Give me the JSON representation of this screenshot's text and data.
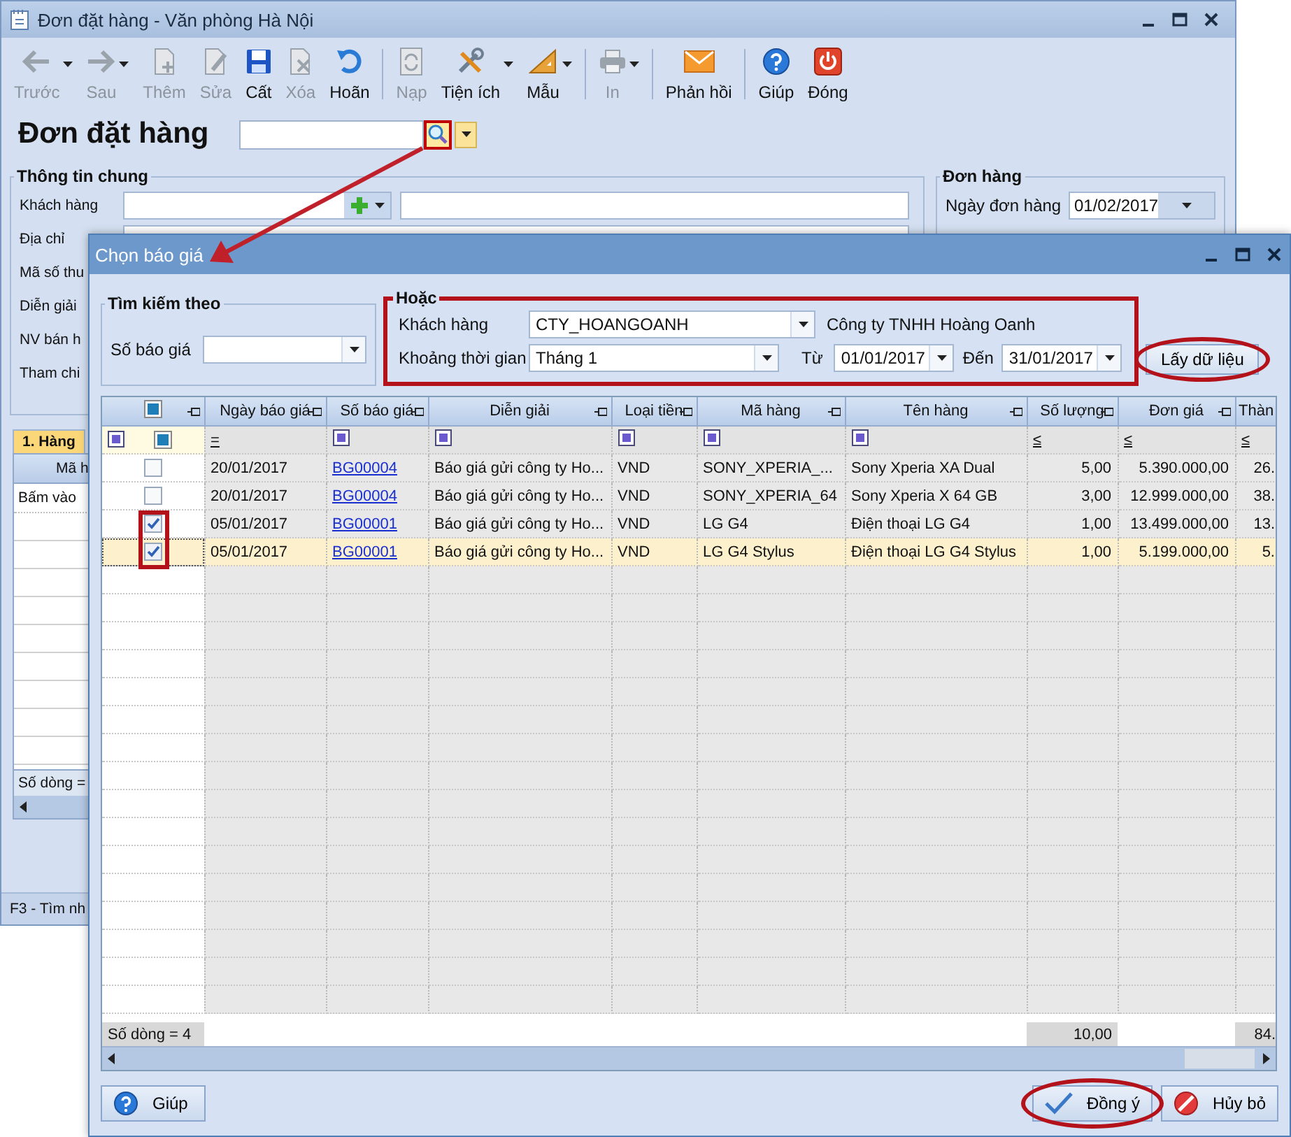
{
  "main_window": {
    "title": "Đơn đặt hàng - Văn phòng Hà Nội",
    "toolbar": [
      {
        "kind": "button",
        "label": "Trước",
        "disabled": true,
        "dropdown": true
      },
      {
        "kind": "button",
        "label": "Sau",
        "disabled": true,
        "dropdown": true
      },
      {
        "kind": "button",
        "label": "Thêm",
        "disabled": true,
        "dropdown": false
      },
      {
        "kind": "button",
        "label": "Sửa",
        "disabled": true,
        "dropdown": false
      },
      {
        "kind": "button",
        "label": "Cất",
        "disabled": false,
        "dropdown": false
      },
      {
        "kind": "button",
        "label": "Xóa",
        "disabled": true,
        "dropdown": false
      },
      {
        "kind": "button",
        "label": "Hoãn",
        "disabled": false,
        "dropdown": false
      },
      {
        "kind": "separator"
      },
      {
        "kind": "button",
        "label": "Nạp",
        "disabled": true,
        "dropdown": false
      },
      {
        "kind": "button",
        "label": "Tiện ích",
        "disabled": false,
        "dropdown": true
      },
      {
        "kind": "button",
        "label": "Mẫu",
        "disabled": false,
        "dropdown": true
      },
      {
        "kind": "separator"
      },
      {
        "kind": "button",
        "label": "In",
        "disabled": true,
        "dropdown": true
      },
      {
        "kind": "separator"
      },
      {
        "kind": "button",
        "label": "Phản hồi",
        "disabled": false,
        "dropdown": false
      },
      {
        "kind": "separator"
      },
      {
        "kind": "button",
        "label": "Giúp",
        "disabled": false,
        "dropdown": false
      },
      {
        "kind": "button",
        "label": "Đóng",
        "disabled": false,
        "dropdown": false
      }
    ],
    "heading": "Đơn đặt hàng",
    "general_info": {
      "title": "Thông tin chung",
      "labels": [
        "Khách hàng",
        "Địa chỉ",
        "Mã số thu",
        "Diễn giải",
        "NV bán h",
        "Tham chi"
      ]
    },
    "order_info": {
      "title": "Đơn hàng",
      "date_label": "Ngày đơn hàng",
      "date_value": "01/02/2017"
    },
    "detail_tabs": [
      {
        "label": "1. Hàng",
        "selected": true
      }
    ],
    "detail_grid": {
      "column": "Mã h",
      "hint": "Bấm vào",
      "row_count": "Số dòng ="
    },
    "status_bar": "F3 - Tìm nh"
  },
  "dialog": {
    "title": "Chọn báo giá",
    "search_by": {
      "title": "Tìm kiếm theo",
      "label": "Số báo giá"
    },
    "or_group": {
      "title": "Hoặc",
      "customer_label": "Khách hàng",
      "customer_value": "CTY_HOANGOANH",
      "customer_name": "Công ty TNHH Hoàng Oanh",
      "period_label": "Khoảng thời gian",
      "period_value": "Tháng 1",
      "from_label": "Từ",
      "from_value": "01/01/2017",
      "to_label": "Đến",
      "to_value": "31/01/2017"
    },
    "fetch_button": "Lấy dữ liệu",
    "grid": {
      "columns": [
        {
          "label": "Ngày báo giá",
          "kind": "date",
          "filter": {
            "kind": "operator",
            "text": "="
          }
        },
        {
          "label": "Số báo giá",
          "kind": "link",
          "filter": {
            "kind": "square"
          }
        },
        {
          "label": "Diễn giải",
          "kind": "text",
          "filter": {
            "kind": "square"
          }
        },
        {
          "label": "Loại tiền",
          "kind": "text",
          "filter": {
            "kind": "square"
          }
        },
        {
          "label": "Mã hàng",
          "kind": "text",
          "filter": {
            "kind": "square"
          }
        },
        {
          "label": "Tên hàng",
          "kind": "text",
          "filter": {
            "kind": "square"
          }
        },
        {
          "label": "Số lượng",
          "kind": "number",
          "filter": {
            "kind": "operator",
            "text": "≤"
          },
          "total": "10,00"
        },
        {
          "label": "Đơn giá",
          "kind": "number",
          "filter": {
            "kind": "operator",
            "text": "≤"
          }
        },
        {
          "label": "Thàn",
          "kind": "number",
          "filter": {
            "kind": "operator",
            "text": "≤"
          },
          "total": "84."
        }
      ],
      "rows": [
        {
          "checked": false,
          "selected": false,
          "cells": [
            "20/01/2017",
            "BG00004",
            "Báo giá gửi công ty Ho...",
            "VND",
            "SONY_XPERIA_...",
            "Sony Xperia XA Dual",
            "5,00",
            "5.390.000,00",
            "26."
          ]
        },
        {
          "checked": false,
          "selected": false,
          "cells": [
            "20/01/2017",
            "BG00004",
            "Báo giá gửi công ty Ho...",
            "VND",
            "SONY_XPERIA_64",
            "Sony Xperia X 64 GB",
            "3,00",
            "12.999.000,00",
            "38."
          ]
        },
        {
          "checked": true,
          "selected": false,
          "cells": [
            "05/01/2017",
            "BG00001",
            "Báo giá gửi công ty Ho...",
            "VND",
            "LG G4",
            "Điện thoại LG G4",
            "1,00",
            "13.499.000,00",
            "13."
          ]
        },
        {
          "checked": true,
          "selected": true,
          "cells": [
            "05/01/2017",
            "BG00001",
            "Báo giá gửi công ty Ho...",
            "VND",
            "LG G4 Stylus",
            "Điện thoại LG G4 Stylus",
            "1,00",
            "5.199.000,00",
            "5."
          ]
        }
      ],
      "row_count": "Số dòng = 4"
    },
    "buttons": [
      {
        "kind": "help",
        "label": "Giúp"
      },
      {
        "kind": "confirm",
        "label": "Đồng ý"
      },
      {
        "kind": "cancel",
        "label": "Hủy bỏ"
      }
    ]
  }
}
